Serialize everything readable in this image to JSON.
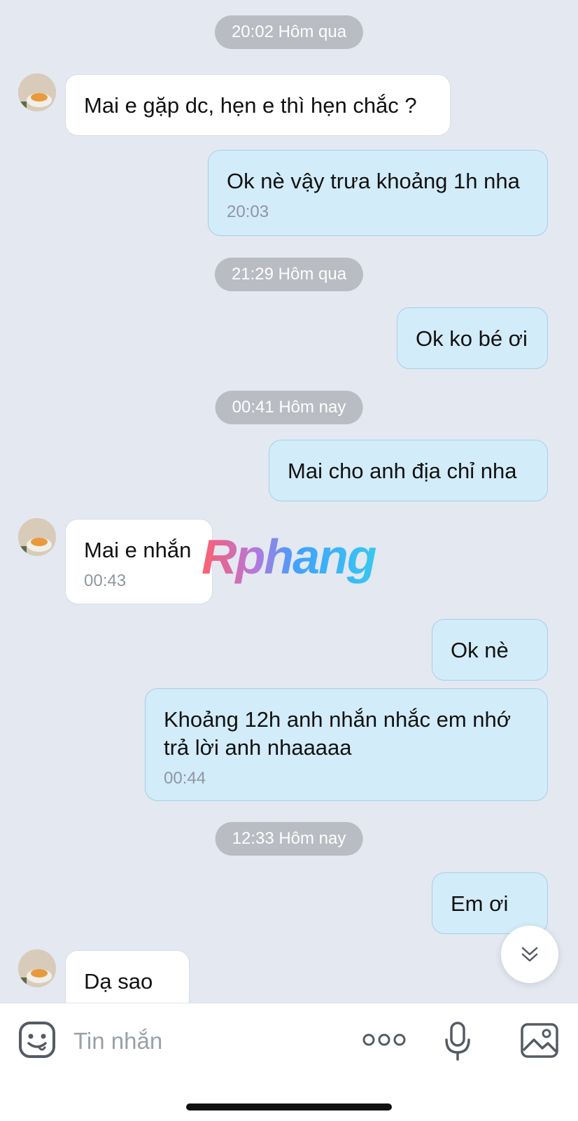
{
  "messages": [
    {
      "type": "time",
      "text": "20:02 Hôm qua"
    },
    {
      "type": "in",
      "text": "Mai e gặp dc, hẹn e thì hẹn chắc ?"
    },
    {
      "type": "out",
      "text": "Ok nè vậy trưa khoảng 1h nha",
      "time": "20:03"
    },
    {
      "type": "time",
      "text": "21:29 Hôm qua"
    },
    {
      "type": "out",
      "text": "Ok ko bé ơi"
    },
    {
      "type": "time",
      "text": "00:41 Hôm nay"
    },
    {
      "type": "out",
      "text": "Mai cho anh địa chỉ nha"
    },
    {
      "type": "in",
      "text": "Mai e nhắn",
      "time": "00:43"
    },
    {
      "type": "out",
      "text": "Ok nè"
    },
    {
      "type": "out",
      "text": "Khoảng 12h anh nhắn nhắc em nhớ trả lời anh nhaaaaa",
      "time": "00:44"
    },
    {
      "type": "time",
      "text": "12:33 Hôm nay"
    },
    {
      "type": "out",
      "text": "Em ơi"
    },
    {
      "type": "in",
      "text": "Dạ sao ạ"
    }
  ],
  "watermark": "Rphang",
  "composer": {
    "placeholder": "Tin nhắn",
    "icons": [
      "sticker-icon",
      "more-icon",
      "microphone-icon",
      "image-icon"
    ]
  },
  "colors": {
    "background": "#e3e8f1",
    "outgoing": "#d2ecf9",
    "incoming": "#ffffff",
    "time_pill": "#b9bcc2"
  }
}
